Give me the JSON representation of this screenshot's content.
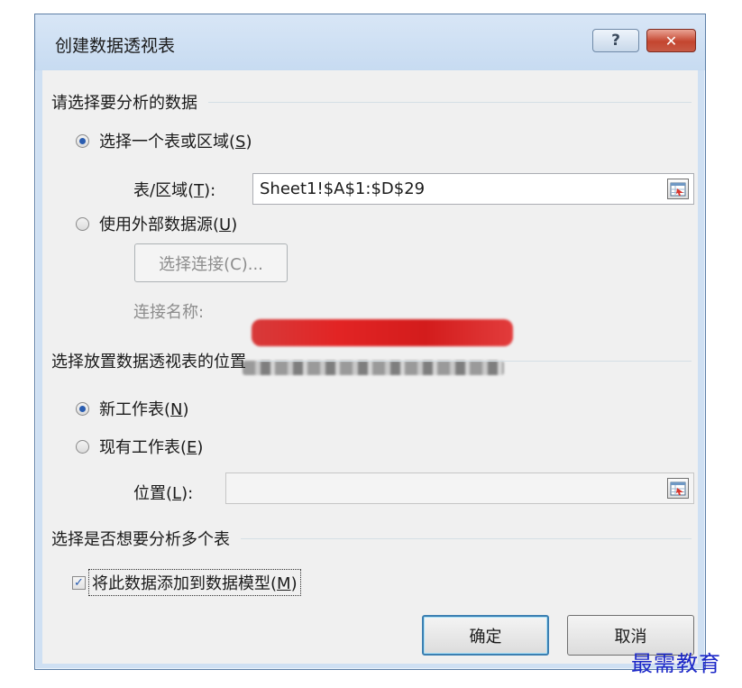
{
  "dialog": {
    "title": "创建数据透视表",
    "help_label": "?",
    "close_label": "✕"
  },
  "section_choose_data": {
    "heading": "请选择要分析的数据",
    "option_table": {
      "text": "选择一个表或区域(",
      "key": "S",
      "end": ")",
      "selected": true
    },
    "range_label": {
      "text": "表/区域(",
      "key": "T",
      "end": "):"
    },
    "range_value": "Sheet1!$A$1:$D$29",
    "option_external": {
      "text": "使用外部数据源(",
      "key": "U",
      "end": ")",
      "selected": false
    },
    "choose_connection_label": "选择连接(C)...",
    "connection_name_label": "连接名称:"
  },
  "section_placement": {
    "heading": "选择放置数据透视表的位置",
    "option_new": {
      "text": "新工作表(",
      "key": "N",
      "end": ")",
      "selected": true
    },
    "option_existing": {
      "text": "现有工作表(",
      "key": "E",
      "end": ")",
      "selected": false
    },
    "location_label": {
      "text": "位置(",
      "key": "L",
      "end": "):"
    },
    "location_value": ""
  },
  "section_multi": {
    "heading": "选择是否想要分析多个表",
    "add_to_model": {
      "text": "将此数据添加到数据模型(",
      "key": "M",
      "end": ")",
      "checked": true
    }
  },
  "buttons": {
    "ok": "确定",
    "cancel": "取消"
  },
  "watermark": "最需教育",
  "colors": {
    "frame_blue": "#cfe0f3",
    "close_red": "#c4452f",
    "radio_dot": "#2a5db0",
    "watermark": "#1c28c8"
  },
  "icons": {
    "help": "question-mark",
    "close": "x-mark",
    "range_picker": "collapse-dialog-grid-icon"
  }
}
